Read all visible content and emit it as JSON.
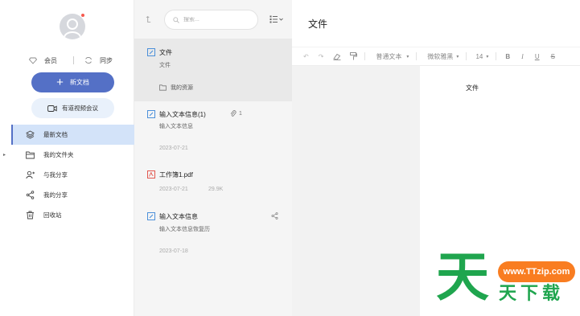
{
  "sidebar": {
    "member_label": "会员",
    "sync_label": "同步",
    "new_doc_label": "新文档",
    "meeting_label": "有道视频会议",
    "nav": [
      {
        "label": "最新文档",
        "icon": "layers-icon",
        "active": true
      },
      {
        "label": "我的文件夹",
        "icon": "folder-icon",
        "active": false
      },
      {
        "label": "与我分享",
        "icon": "user-share-icon",
        "active": false
      },
      {
        "label": "我的分享",
        "icon": "share-icon",
        "active": false
      },
      {
        "label": "回收站",
        "icon": "trash-icon",
        "active": false
      }
    ]
  },
  "list": {
    "search_placeholder": "搜索...",
    "items": [
      {
        "title": "文件",
        "subtitle": "文件",
        "folder": "我的资源",
        "type": "note"
      },
      {
        "title": "输入文本信息(1)",
        "subtitle": "输入文本信息",
        "date": "2023-07-21",
        "attachments": "1",
        "type": "note"
      },
      {
        "title": "工作簿1.pdf",
        "date": "2023-07-21",
        "size": "29.9K",
        "type": "pdf"
      },
      {
        "title": "输入文本信息",
        "subtitle": "输入文本信息恢复历",
        "date": "2023-07-18",
        "type": "note"
      }
    ]
  },
  "editor": {
    "title": "文件",
    "toolbar": {
      "paragraph_style": "普通文本",
      "font_family": "微软雅黑",
      "font_size": "14",
      "bold": "B",
      "italic": "I",
      "underline": "U",
      "strike": "S"
    },
    "body_text": "文件"
  },
  "watermark": {
    "big_char": "天",
    "site": "www.TTzip.com",
    "sub": "天下载"
  },
  "colors": {
    "accent": "#5470c6",
    "nav_active_bg": "#d3e3f9",
    "watermark_green": "#1fa54e",
    "watermark_orange": "#f97d21"
  }
}
